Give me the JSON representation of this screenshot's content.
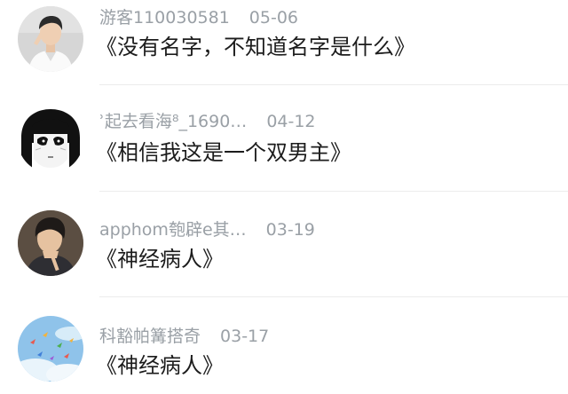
{
  "comments": [
    {
      "username": "游客110030581",
      "date": "05-06",
      "text": "《没有名字，不知道名字是什么》",
      "avatar_icon": "man-white-shirt-avatar"
    },
    {
      "username": "ʾ起去看海⁸_1690…",
      "date": "04-12",
      "text": "《相信我这是一个双男主》",
      "avatar_icon": "anime-girl-avatar"
    },
    {
      "username": "apphom匏辟e其…",
      "date": "03-19",
      "text": "《神经病人》",
      "avatar_icon": "dark-hair-man-avatar"
    },
    {
      "username": "科豁帕篝搭奇",
      "date": "03-17",
      "text": "《神经病人》",
      "avatar_icon": "paper-cranes-sky-avatar"
    }
  ]
}
